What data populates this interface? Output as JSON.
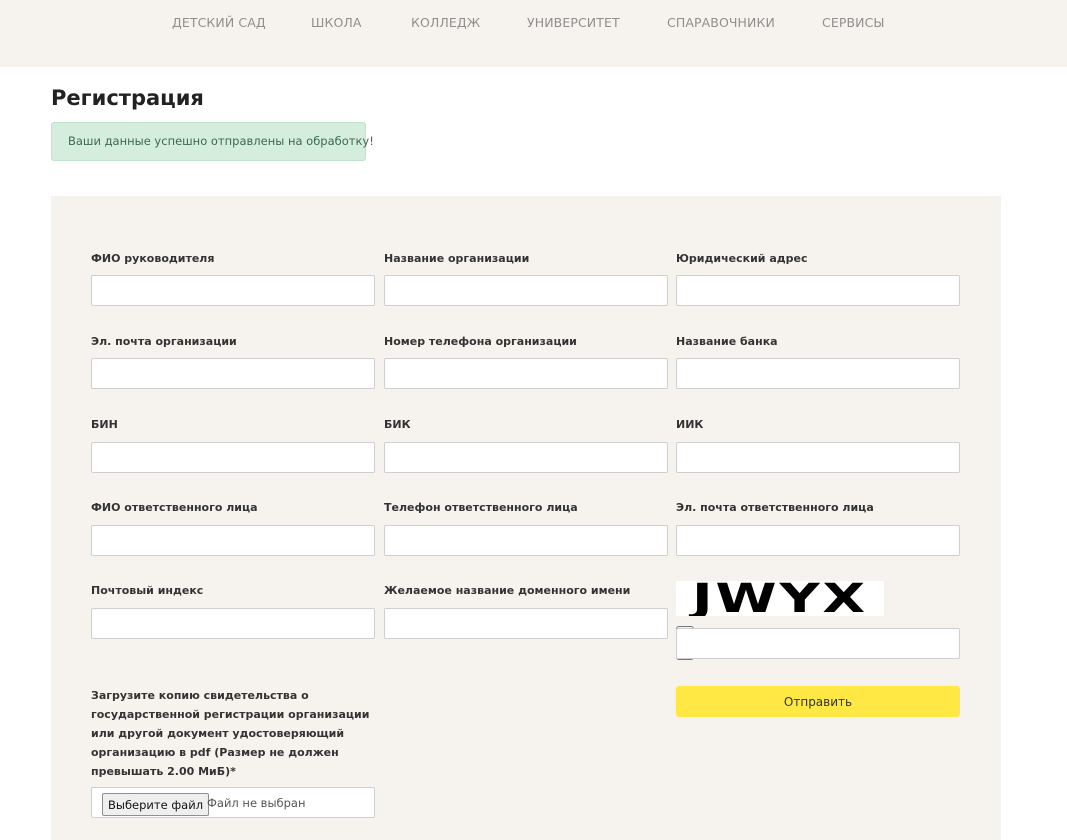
{
  "nav": {
    "items": [
      "ДЕТСКИЙ САД",
      "ШКОЛА",
      "КОЛЛЕДЖ",
      "УНИВЕРСИТЕТ",
      "СПАРАВОЧНИКИ",
      "СЕРВИСЫ"
    ]
  },
  "page": {
    "title": "Регистрация"
  },
  "alert": {
    "text": "Ваши данные успешно отправлены на обработку!",
    "bg_color": "#d4eddd"
  },
  "form": {
    "fields": [
      {
        "label": "ФИО руководителя",
        "value": ""
      },
      {
        "label": "Название организации",
        "value": ""
      },
      {
        "label": "Юридический адрес",
        "value": ""
      },
      {
        "label": "Эл. почта организации",
        "value": ""
      },
      {
        "label": "Номер телефона организации",
        "value": ""
      },
      {
        "label": "Название банка",
        "value": ""
      },
      {
        "label": "БИН",
        "value": ""
      },
      {
        "label": "БИК",
        "value": ""
      },
      {
        "label": "ИИК",
        "value": ""
      },
      {
        "label": "ФИО ответственного лица",
        "value": ""
      },
      {
        "label": "Телефон ответственного лица",
        "value": ""
      },
      {
        "label": "Эл. почта ответственного лица",
        "value": ""
      },
      {
        "label": "Почтовый индекс",
        "value": ""
      },
      {
        "label": "Желаемое название доменного имени",
        "value": ""
      }
    ],
    "captcha": {
      "code": "JWYX",
      "value": "",
      "refresh_icon": "refresh-icon",
      "audio_icon": "audio-icon"
    },
    "upload": {
      "label": "Загрузите копию свидетельства о государственной регистрации организации или другой документ удостоверяющий организацию в pdf (Размер не должен превышать 2.00 МиБ)*",
      "button_label": "Выберите файл",
      "status": "Файл не выбран"
    },
    "submit_label": "Отправить",
    "submit_color": "#ffe843"
  }
}
